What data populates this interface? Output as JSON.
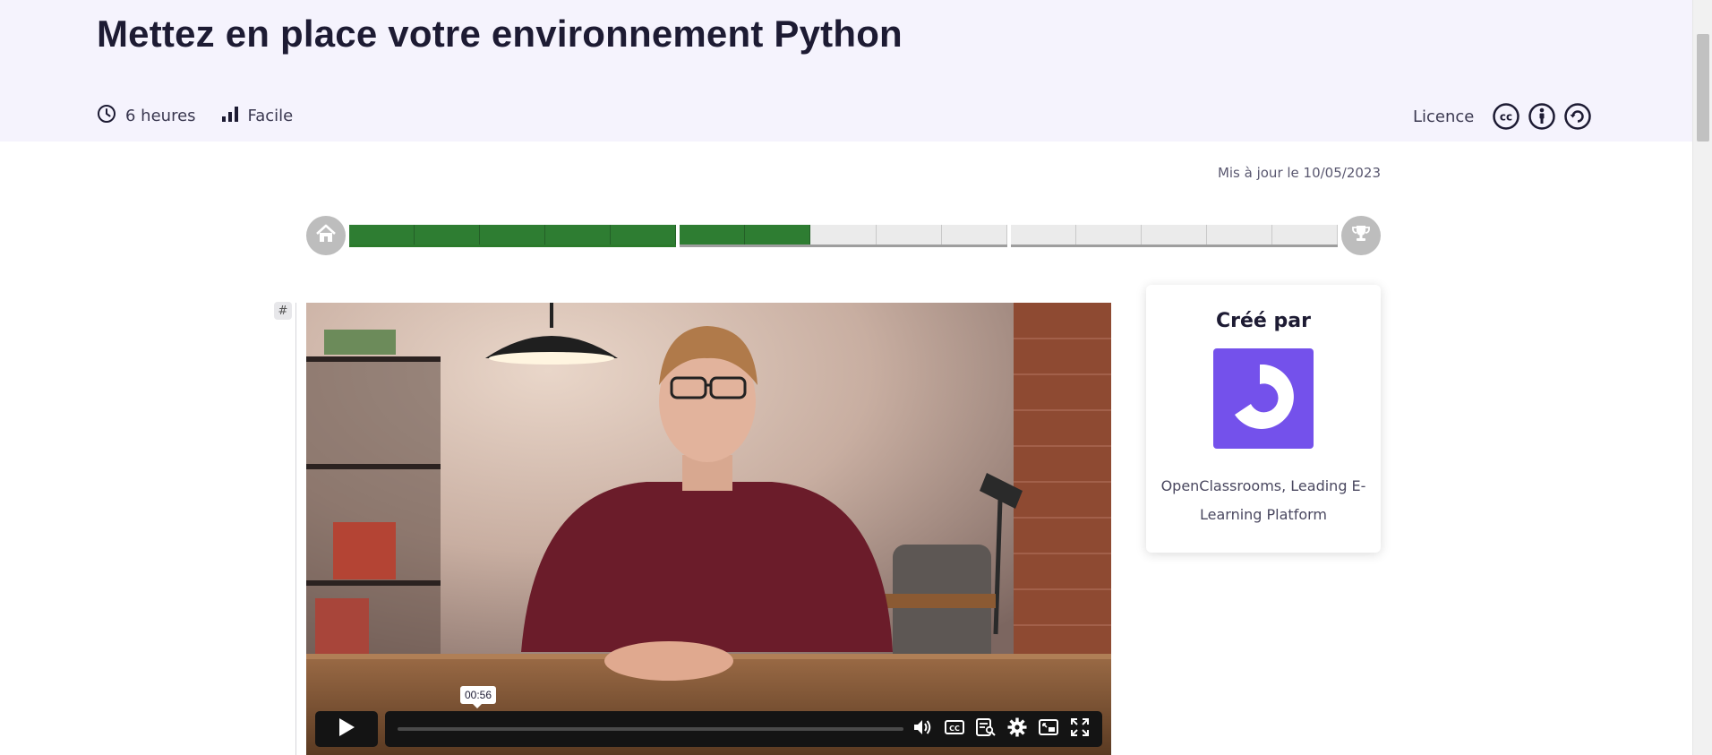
{
  "course": {
    "title": "Mettez en place votre environnement Python",
    "duration": "6 heures",
    "difficulty": "Facile",
    "license_label": "Licence",
    "updated": "Mis à jour le 10/05/2023"
  },
  "progress": {
    "chapters_completed": 1,
    "current_chapter_completed_sections": 2,
    "chapters": [
      {
        "sections": 5,
        "completed": 5
      },
      {
        "sections": 5,
        "completed": 2
      },
      {
        "sections": 5,
        "completed": 0
      }
    ],
    "icons": {
      "start": "home-icon",
      "end": "trophy-icon"
    },
    "colors": {
      "done": "#2e7d32",
      "todo": "#ebebeb",
      "circle": "#bdbdbd"
    }
  },
  "anchor": {
    "symbol": "#"
  },
  "video": {
    "timestamp_tooltip": "00:56",
    "controls": [
      "play-icon",
      "volume-icon",
      "captions-icon",
      "transcript-icon",
      "settings-icon",
      "picture-in-picture-icon",
      "fullscreen-icon"
    ]
  },
  "creator": {
    "heading": "Créé par",
    "name": "OpenClassrooms, Leading E-Learning Platform",
    "logo_color": "#7451eb"
  },
  "colors": {
    "header_bg": "#f5f3fd",
    "title": "#1d1b33"
  }
}
